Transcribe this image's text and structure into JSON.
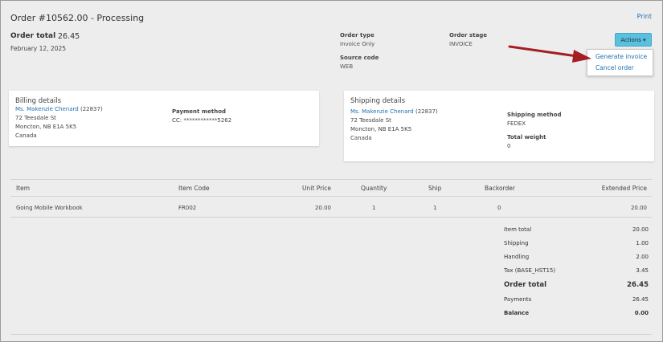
{
  "header": {
    "title": "Order #10562.00 - Processing",
    "print_label": "Print",
    "order_total_label": "Order total",
    "order_total_value": "26.45",
    "date": "February 12, 2025"
  },
  "order_meta": {
    "order_type_label": "Order type",
    "order_type_value": "Invoice Only",
    "order_stage_label": "Order stage",
    "order_stage_value": "INVOICE",
    "source_code_label": "Source code",
    "source_code_value": "WEB"
  },
  "actions": {
    "button_label": "Actions ▾",
    "menu": [
      "Generate invoice",
      "Cancel order"
    ]
  },
  "billing": {
    "title": "Billing details",
    "customer_name": "Ms. Makenzie Chenard",
    "customer_id": "(22837)",
    "address1": "72 Teesdale St",
    "address2": "Moncton, NB E1A 5K5",
    "country": "Canada",
    "payment_method_label": "Payment method",
    "payment_method_value": "CC: ************5262"
  },
  "shipping": {
    "title": "Shipping details",
    "customer_name": "Ms. Makenzie Chenard",
    "customer_id": "(22837)",
    "address1": "72 Teesdale St",
    "address2": "Moncton, NB E1A 5K5",
    "country": "Canada",
    "shipping_method_label": "Shipping method",
    "shipping_method_value": "FEDEX",
    "total_weight_label": "Total weight",
    "total_weight_value": "0"
  },
  "items_table": {
    "headers": [
      "Item",
      "Item Code",
      "Unit Price",
      "Quantity",
      "Ship",
      "Backorder",
      "Extended Price"
    ],
    "rows": [
      [
        "Going Mobile Workbook",
        "FR002",
        "20.00",
        "1",
        "1",
        "0",
        "20.00"
      ]
    ]
  },
  "summary": [
    {
      "label": "Item total",
      "value": "20.00"
    },
    {
      "label": "Shipping",
      "value": "1.00"
    },
    {
      "label": "Handling",
      "value": "2.00"
    },
    {
      "label": "Tax (BASE_HST15)",
      "value": "3.45"
    },
    {
      "label": "Order total",
      "value": "26.45"
    },
    {
      "label": "Payments",
      "value": "26.45"
    },
    {
      "label": "Balance",
      "value": "0.00"
    }
  ],
  "colors": {
    "accent": "#1f6fb3",
    "actions_button": "#5bc0de",
    "arrow": "#a31d24"
  }
}
